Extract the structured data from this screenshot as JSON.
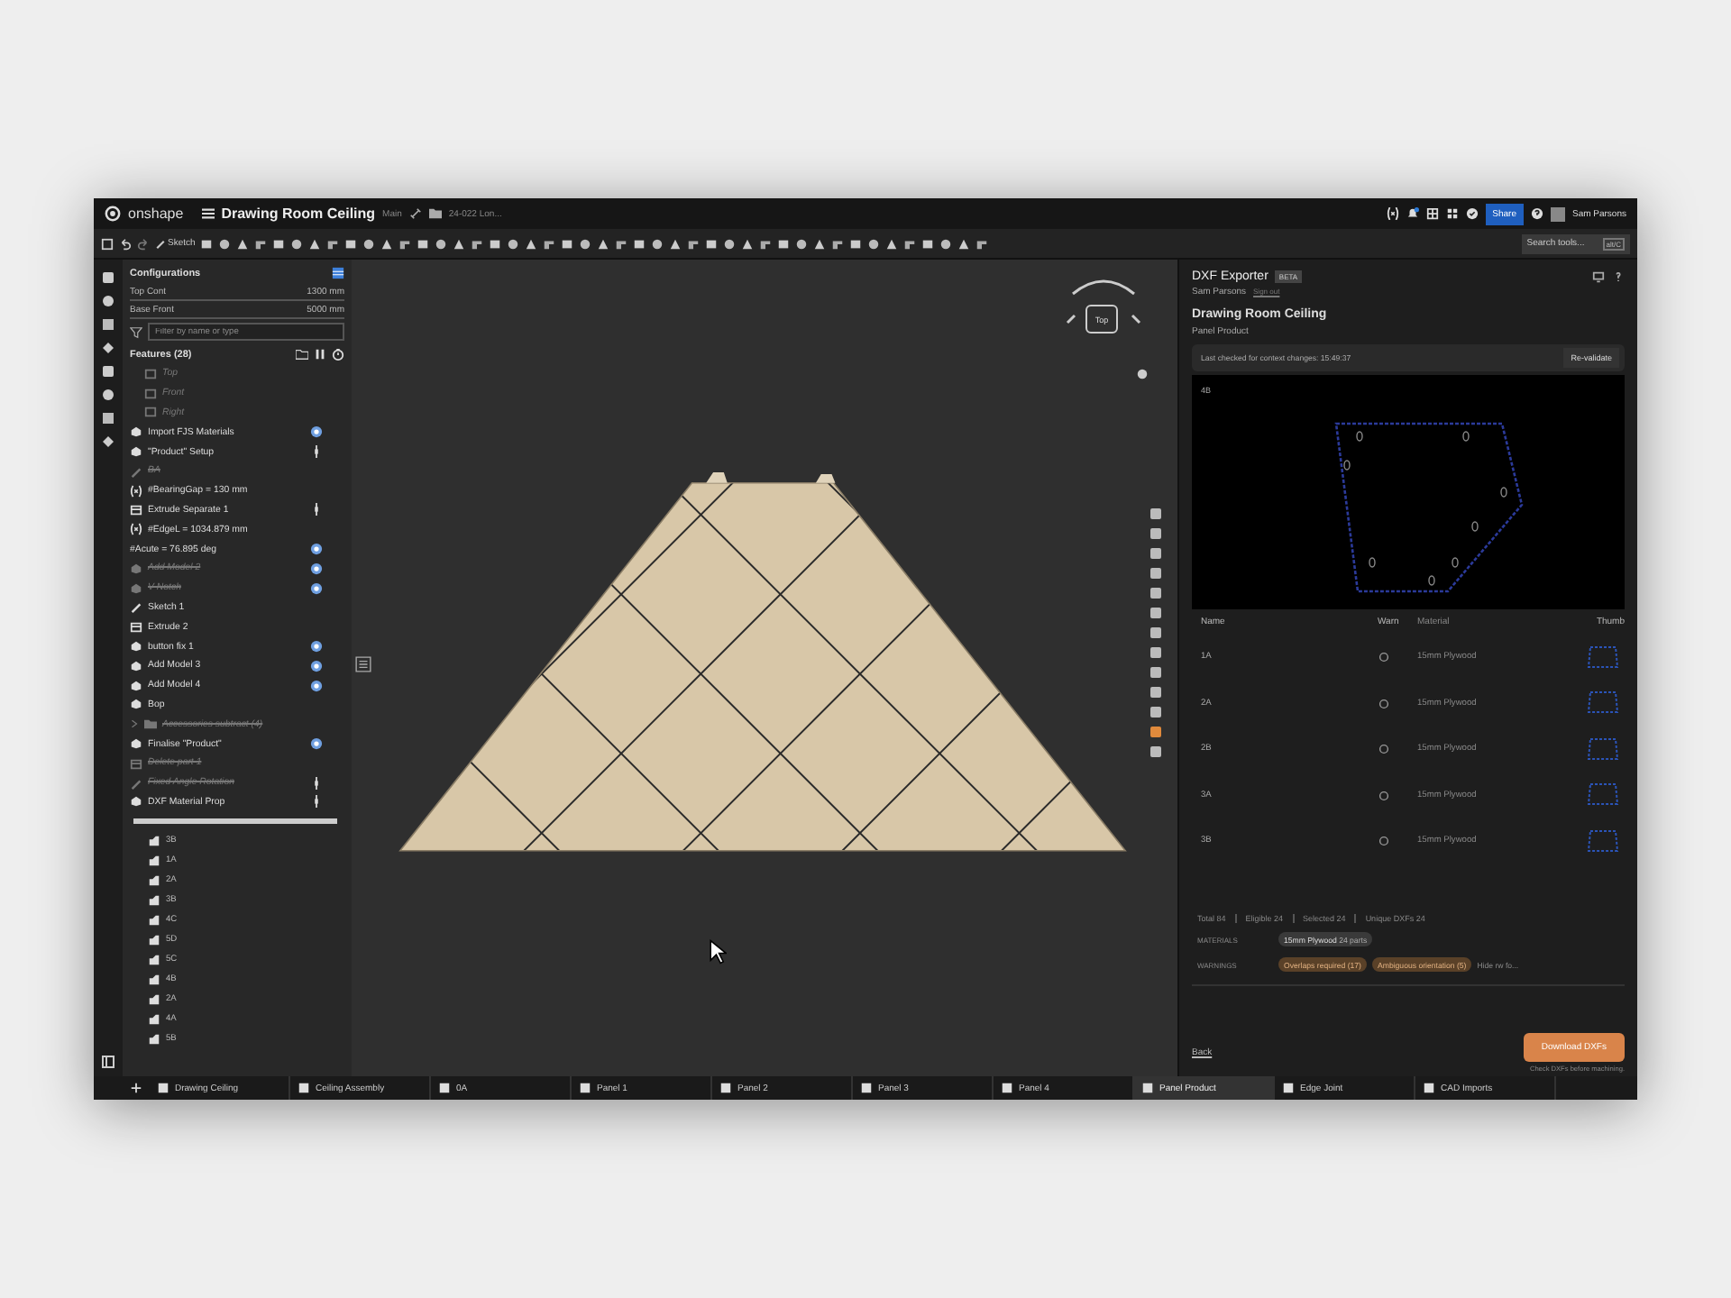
{
  "topbar": {
    "logo": "onshape",
    "document": "Drawing Room Ceiling",
    "branch": "Main",
    "folder": "24-022 Lon...",
    "share": "Share",
    "user": "Sam Parsons"
  },
  "toolbar": {
    "sketch": "Sketch",
    "search_placeholder": "Search tools...",
    "shortcut": "alt/C"
  },
  "configurations": {
    "title": "Configurations",
    "rows": [
      {
        "label": "Top Cont",
        "value": "1300 mm"
      },
      {
        "label": "Base Front",
        "value": "5000 mm"
      }
    ]
  },
  "filter": {
    "placeholder": "Filter by name or type"
  },
  "features": {
    "title": "Features (28)",
    "items": [
      {
        "label": "Top",
        "kind": "plane",
        "suppressed": true,
        "badge": false,
        "pinned": false
      },
      {
        "label": "Front",
        "kind": "plane",
        "suppressed": true,
        "badge": false,
        "pinned": false
      },
      {
        "label": "Right",
        "kind": "plane",
        "suppressed": true,
        "badge": false,
        "pinned": false
      },
      {
        "label": "Import FJS Materials",
        "kind": "feature",
        "suppressed": false,
        "badge": true,
        "pinned": false
      },
      {
        "label": "\"Product\" Setup",
        "kind": "feature",
        "suppressed": false,
        "badge": false,
        "pinned": true
      },
      {
        "label": "BA",
        "kind": "sketch",
        "suppressed": true,
        "badge": false,
        "pinned": false
      },
      {
        "label": "#BearingGap = 130 mm",
        "kind": "variable",
        "suppressed": false,
        "badge": false,
        "pinned": false
      },
      {
        "label": "Extrude Separate 1",
        "kind": "extrude",
        "suppressed": false,
        "badge": false,
        "pinned": true
      },
      {
        "label": "#EdgeL = 1034.879 mm",
        "kind": "variable",
        "suppressed": false,
        "badge": false,
        "pinned": false
      },
      {
        "label": "#Acute = 76.895 deg",
        "kind": "plain",
        "suppressed": false,
        "badge": true,
        "pinned": false
      },
      {
        "label": "Add Model 2",
        "kind": "feature",
        "suppressed": true,
        "badge": true,
        "pinned": false
      },
      {
        "label": "V Notch",
        "kind": "feature",
        "suppressed": true,
        "badge": true,
        "pinned": false
      },
      {
        "label": "Sketch 1",
        "kind": "sketch",
        "suppressed": false,
        "badge": false,
        "pinned": false
      },
      {
        "label": "Extrude 2",
        "kind": "extrude",
        "suppressed": false,
        "badge": false,
        "pinned": false
      },
      {
        "label": "button fix 1",
        "kind": "feature",
        "suppressed": false,
        "badge": true,
        "pinned": false
      },
      {
        "label": "Add Model 3",
        "kind": "feature",
        "suppressed": false,
        "badge": true,
        "pinned": false
      },
      {
        "label": "Add Model 4",
        "kind": "feature",
        "suppressed": false,
        "badge": true,
        "pinned": false
      },
      {
        "label": "Bop",
        "kind": "feature",
        "suppressed": false,
        "badge": false,
        "pinned": false
      },
      {
        "label": "Accessories subtract (4)",
        "kind": "folder",
        "suppressed": true,
        "badge": false,
        "pinned": false
      },
      {
        "label": "Finalise \"Product\"",
        "kind": "feature",
        "suppressed": false,
        "badge": true,
        "pinned": false
      },
      {
        "label": "Delete part 1",
        "kind": "extrude",
        "suppressed": true,
        "badge": false,
        "pinned": false
      },
      {
        "label": "Fixed Angle Rotation",
        "kind": "sketch",
        "suppressed": true,
        "badge": false,
        "pinned": true
      },
      {
        "label": "DXF Material Prop",
        "kind": "feature",
        "suppressed": false,
        "badge": false,
        "pinned": true
      }
    ]
  },
  "parts": [
    "3B",
    "1A",
    "2A",
    "3B",
    "4C",
    "5D",
    "5C",
    "4B",
    "2A",
    "4A",
    "5B"
  ],
  "viewcube": {
    "face": "Top"
  },
  "exporter": {
    "title": "DXF Exporter",
    "badge": "BETA",
    "user": "Sam Parsons",
    "sign_out": "Sign out",
    "document": "Drawing Room Ceiling",
    "part_studio": "Panel Product",
    "status": "Last checked for context changes: 15:49:37",
    "revalidate": "Re-validate",
    "preview_label": "4B",
    "columns": [
      "Name",
      "Warn",
      "Material",
      "Thumb"
    ],
    "rows": [
      {
        "name": "1A",
        "material": "15mm Plywood"
      },
      {
        "name": "2A",
        "material": "15mm Plywood"
      },
      {
        "name": "2B",
        "material": "15mm Plywood"
      },
      {
        "name": "3A",
        "material": "15mm Plywood"
      },
      {
        "name": "3B",
        "material": "15mm Plywood"
      }
    ],
    "summary": [
      "Total 84",
      "Eligible 24",
      "Selected 24",
      "Unique DXFs 24"
    ],
    "materials_label": "MATERIALS",
    "materials": [
      {
        "name": "15mm Plywood",
        "count": "24 parts"
      }
    ],
    "warnings_label": "WARNINGS",
    "warnings": [
      "Overlaps required (17)",
      "Ambiguous orientation (5)"
    ],
    "warnings_more": "Hide rw fo...",
    "back": "Back",
    "download": "Download DXFs",
    "note": "Check DXFs before machining."
  },
  "tabs": [
    {
      "label": "Drawing Ceiling",
      "selected": false
    },
    {
      "label": "Ceiling Assembly",
      "selected": false
    },
    {
      "label": "0A",
      "selected": false
    },
    {
      "label": "Panel 1",
      "selected": false
    },
    {
      "label": "Panel 2",
      "selected": false
    },
    {
      "label": "Panel 3",
      "selected": false
    },
    {
      "label": "Panel 4",
      "selected": false
    },
    {
      "label": "Panel Product",
      "selected": true
    },
    {
      "label": "Edge Joint",
      "selected": false
    },
    {
      "label": "CAD Imports",
      "selected": false
    }
  ]
}
